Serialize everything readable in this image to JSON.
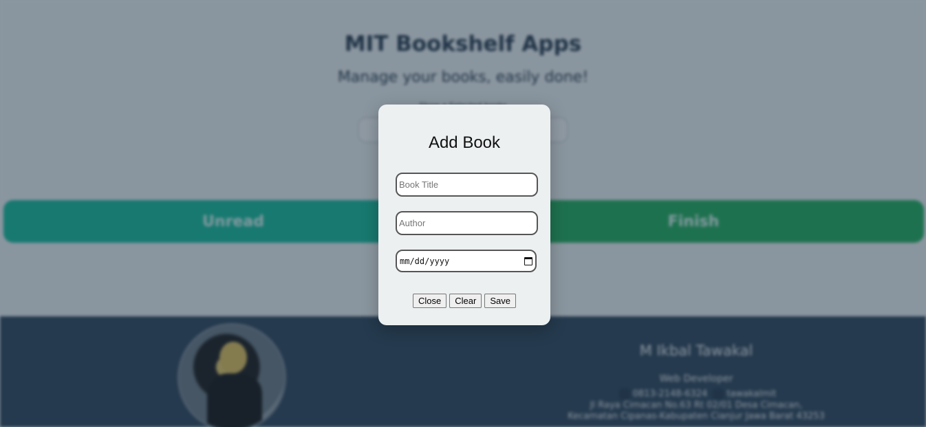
{
  "app": {
    "title": "MIT Bookshelf Apps",
    "subtitle": "Manage your books, easily done!",
    "small_text": "Show a Selected books"
  },
  "tabs": [
    {
      "label": "Unread",
      "color": "#1abc9c"
    },
    {
      "label": "Finish",
      "color": "#27ae60"
    }
  ],
  "footer": {
    "name": "M Ikbal Tawakal",
    "role": "Web Developer",
    "phone": "0813-2148-6324",
    "social": "tawakalmit",
    "address_line1": "Jl Raya Cimacan No.63 Rt 02/01 Desa Cimacan,",
    "address_line2": "Kecamatan Cipanas-Kabupaten Cianjur Jawa Barat 43253"
  },
  "modal": {
    "title": "Add Book",
    "fields": {
      "title_placeholder": "Book Title",
      "author_placeholder": "Author",
      "date_placeholder": "mm/dd/yyyy"
    },
    "buttons": {
      "close": "Close",
      "clear": "Clear",
      "save": "Save"
    }
  },
  "icons": {
    "whatsapp": "whatsapp-icon",
    "instagram": "instagram-icon",
    "calendar": "calendar-icon"
  }
}
